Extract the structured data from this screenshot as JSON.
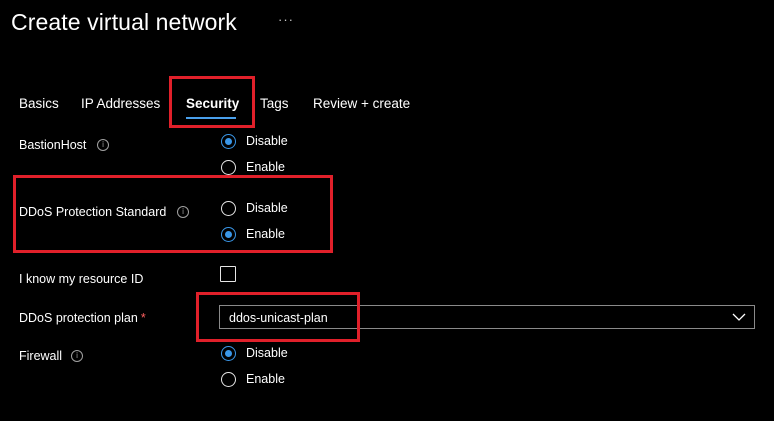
{
  "header": {
    "title": "Create virtual network",
    "more_label": "···"
  },
  "tabs": [
    {
      "label": "Basics",
      "active": false
    },
    {
      "label": "IP Addresses",
      "active": false
    },
    {
      "label": "Security",
      "active": true
    },
    {
      "label": "Tags",
      "active": false
    },
    {
      "label": "Review + create",
      "active": false
    }
  ],
  "form": {
    "bastion_host": {
      "label": "BastionHost",
      "options": [
        "Disable",
        "Enable"
      ],
      "selected": "Disable"
    },
    "ddos_standard": {
      "label": "DDoS Protection Standard",
      "options": [
        "Disable",
        "Enable"
      ],
      "selected": "Enable"
    },
    "resource_id": {
      "label": "I know my resource ID",
      "checked": false
    },
    "ddos_plan": {
      "label": "DDoS protection plan",
      "required_mark": "*",
      "value": "ddos-unicast-plan"
    },
    "firewall": {
      "label": "Firewall",
      "options": [
        "Disable",
        "Enable"
      ],
      "selected": "Disable"
    }
  },
  "colors": {
    "background": "#000000",
    "accent": "#3a97e8",
    "highlight": "#e0202a",
    "required": "#ff6060"
  },
  "icons": {
    "info": "i",
    "more": "more-horizontal-icon",
    "dropdown": "chevron-down-icon"
  }
}
